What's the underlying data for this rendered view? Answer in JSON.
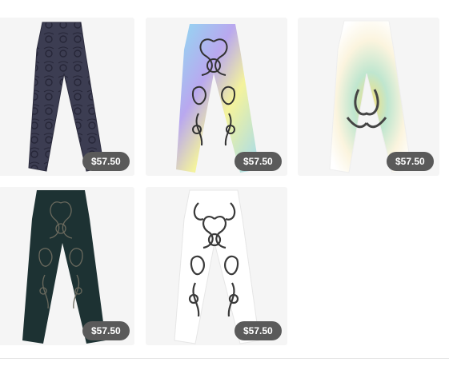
{
  "products": [
    {
      "price": "$57.50",
      "design": "navy-paisley-pattern"
    },
    {
      "price": "$57.50",
      "design": "pastel-gradient-mandala"
    },
    {
      "price": "$57.50",
      "design": "cream-yellow-teal-flower"
    },
    {
      "price": "$57.50",
      "design": "dark-teal-mandala"
    },
    {
      "price": "$57.50",
      "design": "white-black-mandala"
    }
  ]
}
